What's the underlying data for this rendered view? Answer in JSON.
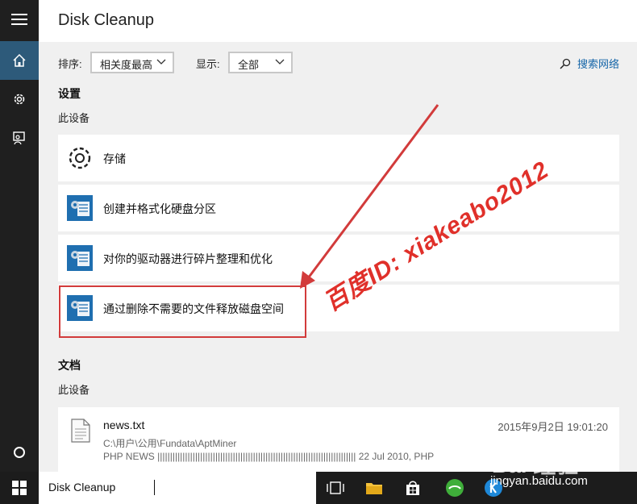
{
  "app": {
    "title": "Disk Cleanup"
  },
  "filters": {
    "sort_label": "排序:",
    "sort_value": "相关度最高",
    "show_label": "显示:",
    "show_value": "全部",
    "search_web": "搜索网络"
  },
  "settings": {
    "heading": "设置",
    "sub": "此设备",
    "items": [
      {
        "label": "存储",
        "icon": "gear-icon"
      },
      {
        "label": "创建并格式化硬盘分区",
        "icon": "control-panel-icon"
      },
      {
        "label": "对你的驱动器进行碎片整理和优化",
        "icon": "control-panel-icon"
      },
      {
        "label": "通过删除不需要的文件释放磁盘空间",
        "icon": "control-panel-icon"
      }
    ]
  },
  "documents": {
    "heading": "文档",
    "sub": "此设备",
    "items": [
      {
        "name": "news.txt",
        "path": "C:\\用户\\公用\\Fundata\\AptMiner",
        "snippet": "PHP NEWS ||||||||||||||||||||||||||||||||||||||||||||||||||||||||||||||||||||||||||||||| 22 Jul 2010, PHP",
        "date": "2015年9月2日 19:01:20"
      }
    ]
  },
  "taskbar": {
    "search_query": "Disk Cleanup"
  },
  "overlay": {
    "watermark": "百度ID: xiakeabo2012",
    "logo": "Bai 经验",
    "site": "jingyan.baidu.com"
  },
  "colors": {
    "accent": "#2d5a7a",
    "link": "#1565a8",
    "highlight": "#d23b3b",
    "rail": "#1f1f1f"
  }
}
